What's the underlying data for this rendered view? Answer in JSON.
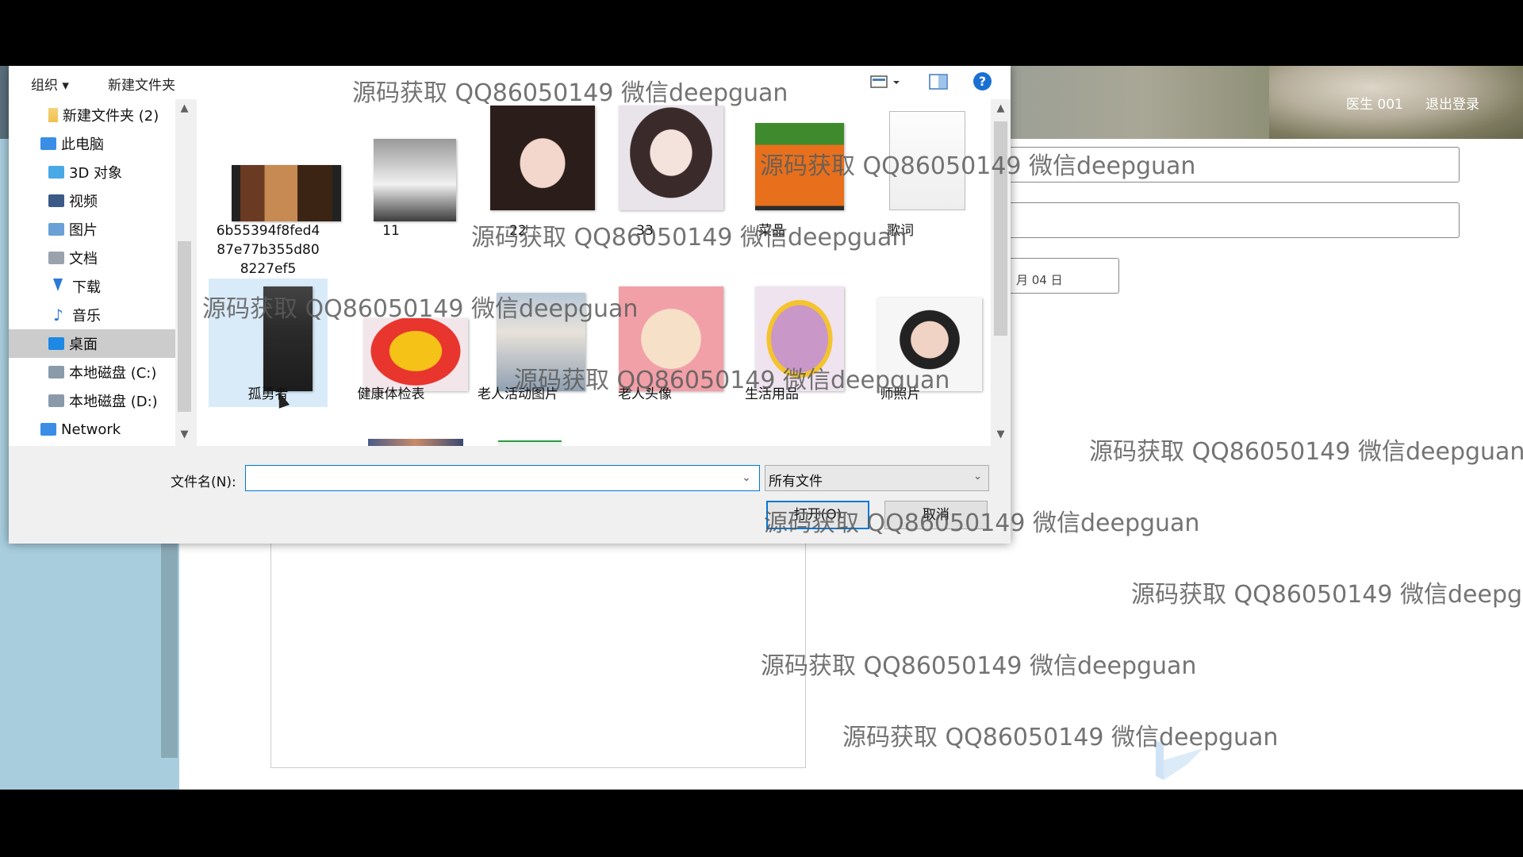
{
  "app": {
    "user_name": "医生 001",
    "logout_label": "退出登录",
    "date_partial": "月 04 日"
  },
  "dialog": {
    "toolbar": {
      "organize_label": "组织 ▾",
      "new_folder_label": "新建文件夹",
      "help_label": "?"
    },
    "nav": [
      {
        "label": "新建文件夹 (2)",
        "icon": "folder-icon"
      },
      {
        "label": "此电脑",
        "icon": "computer-icon"
      },
      {
        "label": "3D 对象",
        "icon": "3d-objects-icon"
      },
      {
        "label": "视频",
        "icon": "video-icon"
      },
      {
        "label": "图片",
        "icon": "pictures-icon"
      },
      {
        "label": "文档",
        "icon": "documents-icon"
      },
      {
        "label": "下载",
        "icon": "download-icon"
      },
      {
        "label": "音乐",
        "icon": "music-icon"
      },
      {
        "label": "桌面",
        "icon": "desktop-icon",
        "selected": true
      },
      {
        "label": "本地磁盘 (C:)",
        "icon": "drive-icon"
      },
      {
        "label": "本地磁盘 (D:)",
        "icon": "drive-icon"
      },
      {
        "label": "Network",
        "icon": "network-icon"
      }
    ],
    "files": [
      {
        "label": "6b55394f8fed487e77b355d808227ef5",
        "label_lines": [
          "6b55394f8fed4",
          "87e77b355d80",
          "8227ef5"
        ],
        "thumb": "video-film-icon"
      },
      {
        "label": "11",
        "thumb": "photo-person-white-shirt"
      },
      {
        "label": "22",
        "thumb": "photo-woman-portrait"
      },
      {
        "label": "33",
        "thumb": "illustration-girl"
      },
      {
        "label": "菜品",
        "thumb": "photo-carrots"
      },
      {
        "label": "歌词",
        "thumb": "text-document-icon"
      },
      {
        "label": "孤勇者",
        "thumb": "screenshot-music-player",
        "selected": true
      },
      {
        "label": "健康体检表",
        "thumb": "poster-health-check"
      },
      {
        "label": "老人活动图片",
        "thumb": "photo-elderly-couple"
      },
      {
        "label": "老人头像",
        "thumb": "illustration-old-woman"
      },
      {
        "label": "生活用品",
        "thumb": "photo-slippers"
      },
      {
        "label": "师照片",
        "thumb": "photo-nurse"
      }
    ],
    "filename_label": "文件名(N):",
    "filename_value": "",
    "filetype_value": "所有文件",
    "open_label": "打开(O)",
    "cancel_label": "取消"
  },
  "watermark_text": "源码获取 QQ86050149 微信deepguan",
  "watermark_text_cut": "源码获取 QQ86050149 微信deepgu",
  "colors": {
    "accent": "#0078d7",
    "sidebar": "#a8cede",
    "selection": "#d9ebf9"
  }
}
